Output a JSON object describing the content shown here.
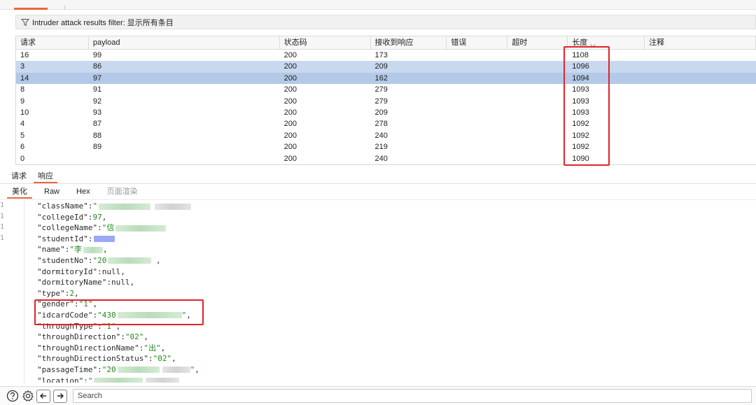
{
  "filter": {
    "text": "Intruder attack results filter: 显示所有条目"
  },
  "table": {
    "columns": [
      "请求",
      "payload",
      "状态码",
      "接收到响应",
      "错误",
      "超时",
      "长度",
      "注释"
    ],
    "rows": [
      [
        "16",
        "99",
        "200",
        "173",
        "",
        "",
        "1108",
        ""
      ],
      [
        "3",
        "86",
        "200",
        "209",
        "",
        "",
        "1096",
        ""
      ],
      [
        "14",
        "97",
        "200",
        "162",
        "",
        "",
        "1094",
        ""
      ],
      [
        "8",
        "91",
        "200",
        "279",
        "",
        "",
        "1093",
        ""
      ],
      [
        "9",
        "92",
        "200",
        "279",
        "",
        "",
        "1093",
        ""
      ],
      [
        "10",
        "93",
        "200",
        "209",
        "",
        "",
        "1093",
        ""
      ],
      [
        "4",
        "87",
        "200",
        "278",
        "",
        "",
        "1092",
        ""
      ],
      [
        "5",
        "88",
        "200",
        "240",
        "",
        "",
        "1092",
        ""
      ],
      [
        "6",
        "89",
        "200",
        "219",
        "",
        "",
        "1092",
        ""
      ],
      [
        "0",
        "",
        "200",
        "240",
        "",
        "",
        "1090",
        ""
      ]
    ],
    "selected_rows": [
      1,
      2
    ]
  },
  "req_resp_tabs": {
    "request": "请求",
    "response": "响应"
  },
  "view_tabs": {
    "pretty": "美化",
    "raw": "Raw",
    "hex": "Hex",
    "render": "页面渲染"
  },
  "gutter": [
    "1",
    "1",
    "1",
    "1"
  ],
  "code": {
    "l1_key": "\"className\"",
    "l1_val": "\"",
    "l2_key": "\"collegeId\"",
    "l2_val": "97",
    "l3_key": "\"collegeName\"",
    "l3_val": "\"信",
    "l4_key": "\"studentId\"",
    "l5_key": "\"name\"",
    "l5_val": "\"李",
    "l6_key": "\"studentNo\"",
    "l6_val": "\"20",
    "l7_key": "\"dormitoryId\"",
    "l7_val": "null",
    "l8_key": "\"dormitoryName\"",
    "l8_val": "null",
    "l9_key": "\"type\"",
    "l9_val": "2",
    "l10_key": "\"gender\"",
    "l10_val": "\"1\"",
    "l11_key": "\"idcardCode\"",
    "l11_val": "\"430",
    "l11_end": "\"",
    "l12_key": "\"throughType\"",
    "l12_val": "\"1\"",
    "l13_key": "\"throughDirection\"",
    "l13_val": "\"02\"",
    "l14_key": "\"throughDirectionName\"",
    "l14_val": "\"出\"",
    "l15_key": "\"throughDirectionStatus\"",
    "l15_val": "\"02\"",
    "l16_key": "\"passageTime\"",
    "l16_val": "\"20",
    "l16_end": "\"",
    "l17_key": "\"location\"",
    "l17_val": "\""
  },
  "search": {
    "placeholder": "Search"
  },
  "icons": {
    "filter": "funnel-icon",
    "help": "help-icon",
    "settings": "gear-icon",
    "back": "arrow-left-icon",
    "forward": "arrow-right-icon",
    "sort": "chevron-down-icon"
  },
  "colors": {
    "accent": "#e8663f",
    "highlight_box": "#e0242a",
    "selected_row": "#c8d8ee",
    "string": "#1e8a1e"
  }
}
